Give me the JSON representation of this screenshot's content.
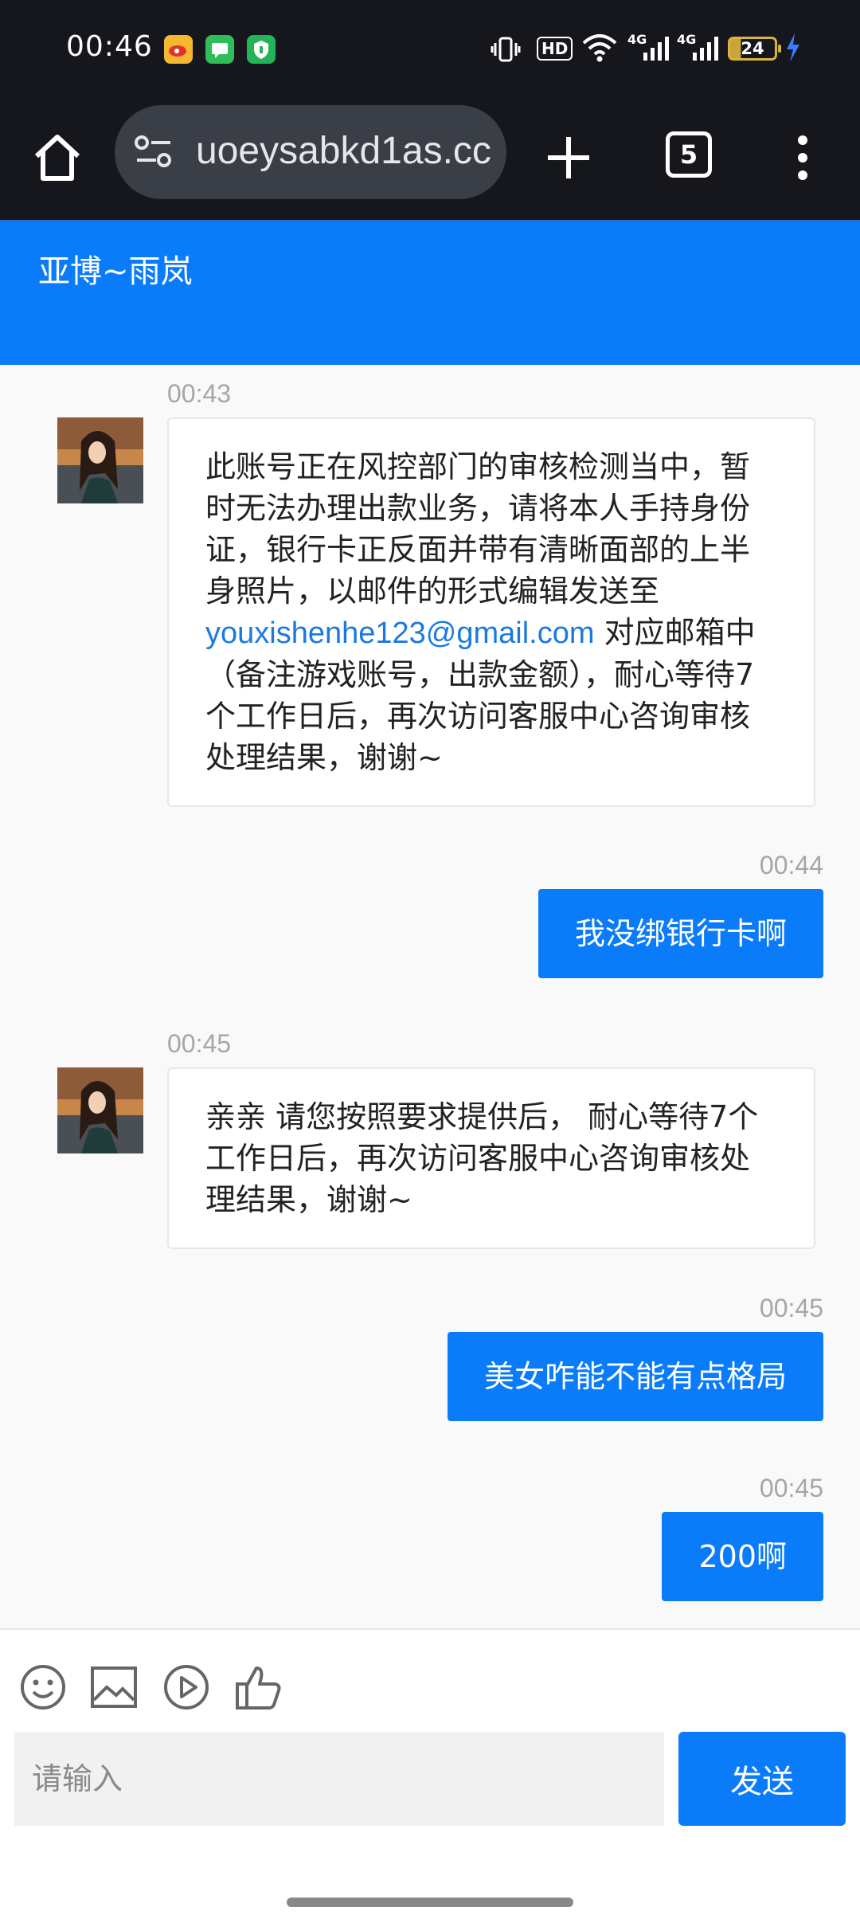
{
  "status_bar": {
    "time": "00:46",
    "battery_level": "24",
    "network_1": "4G",
    "network_2": "4G",
    "hd_label": "HD",
    "icons": [
      "weibo-app-icon",
      "messages-app-icon",
      "security-app-icon",
      "vibrate-icon",
      "wifi-icon",
      "signal-icon",
      "battery-icon",
      "charging-icon"
    ]
  },
  "browser": {
    "url": "uoeysabkd1as.cc",
    "tab_count": "5",
    "icons": [
      "home-icon",
      "site-settings-icon",
      "new-tab-icon",
      "menu-icon"
    ]
  },
  "chat": {
    "title": "亚博~雨岚",
    "messages": [
      {
        "side": "in",
        "time": "00:43",
        "text_before": "此账号正在风控部门的审核检测当中，暂时无法办理出款业务，请将本人手持身份证，银行卡正反面并带有清晰面部的上半身照片，以邮件的形式编辑发送至",
        "email": "youxishenhe123@gmail.com",
        "text_after": " 对应邮箱中（备注游戏账号，出款金额），耐心等待7个工作日后，再次访问客服中心咨询审核处理结果，谢谢~"
      },
      {
        "side": "out",
        "time": "00:44",
        "text": "我没绑银行卡啊"
      },
      {
        "side": "in",
        "time": "00:45",
        "text": "亲亲 请您按照要求提供后， 耐心等待7个工作日后，再次访问客服中心咨询审核处理结果，谢谢~"
      },
      {
        "side": "out",
        "time": "00:45",
        "text": "美女咋能不能有点格局"
      },
      {
        "side": "out",
        "time": "00:45",
        "text": "200啊"
      }
    ]
  },
  "composer": {
    "placeholder": "请输入",
    "send_label": "发送",
    "icons": [
      "emoji-icon",
      "image-icon",
      "video-icon",
      "thumbs-up-icon"
    ]
  },
  "colors": {
    "accent": "#0a7cfa",
    "status_bg": "#15171c",
    "chat_bg": "#f9f9f9",
    "link": "#1a7ae0"
  }
}
